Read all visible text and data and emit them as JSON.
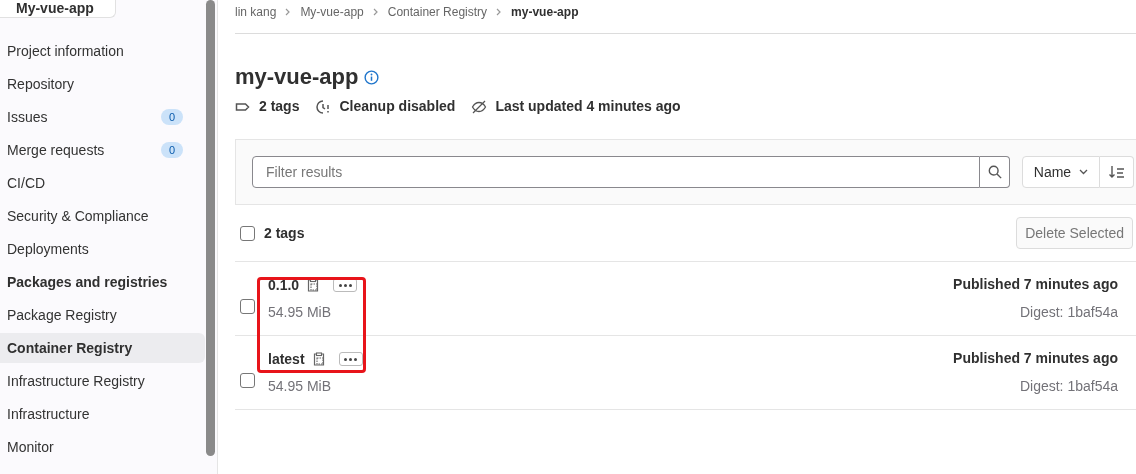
{
  "sidebar": {
    "project": "My-vue-app",
    "items": [
      {
        "label": "Project information",
        "selected": false,
        "group_active": false
      },
      {
        "label": "Repository",
        "selected": false,
        "group_active": false
      },
      {
        "label": "Issues",
        "count": "0",
        "selected": false,
        "group_active": false
      },
      {
        "label": "Merge requests",
        "count": "0",
        "selected": false,
        "group_active": false
      },
      {
        "label": "CI/CD",
        "selected": false,
        "group_active": false
      },
      {
        "label": "Security & Compliance",
        "selected": false,
        "group_active": false
      },
      {
        "label": "Deployments",
        "selected": false,
        "group_active": false
      },
      {
        "label": "Packages and registries",
        "selected": false,
        "group_active": true
      },
      {
        "label": "Package Registry",
        "selected": false,
        "group_active": false
      },
      {
        "label": "Container Registry",
        "selected": true,
        "group_active": false
      },
      {
        "label": "Infrastructure Registry",
        "selected": false,
        "group_active": false
      },
      {
        "label": "Infrastructure",
        "selected": false,
        "group_active": false
      },
      {
        "label": "Monitor",
        "selected": false,
        "group_active": false
      }
    ]
  },
  "breadcrumb": [
    "lin kang",
    "My-vue-app",
    "Container Registry",
    "my-vue-app"
  ],
  "title": "my-vue-app",
  "meta": [
    {
      "kind": "tag",
      "text": "2 tags"
    },
    {
      "kind": "cleanup",
      "text": "Cleanup disabled"
    },
    {
      "kind": "updated",
      "text": "Last updated 4 minutes ago"
    }
  ],
  "filter": {
    "placeholder": "Filter results",
    "sort": "Name"
  },
  "list_header": {
    "label": "2 tags",
    "checked": false,
    "delete_button": "Delete Selected"
  },
  "tags": [
    {
      "name": "0.1.0",
      "size": "54.95 MiB",
      "published": "Published 7 minutes ago",
      "digest": "Digest: 1baf54a",
      "checked": false
    },
    {
      "name": "latest",
      "size": "54.95 MiB",
      "published": "Published 7 minutes ago",
      "digest": "Digest: 1baf54a",
      "checked": false
    }
  ]
}
